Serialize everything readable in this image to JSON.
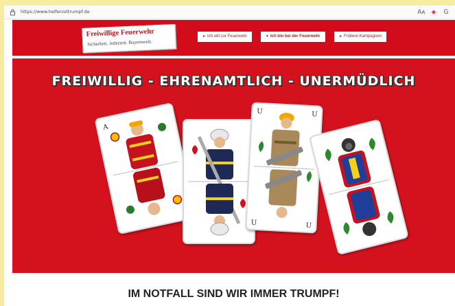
{
  "browser": {
    "url": "https://www.helfenisttrumpf.de",
    "icons": [
      "lock-icon",
      "translate-icon",
      "shield-extension-icon",
      "grid-icon"
    ]
  },
  "header": {
    "logo_title": "Freiwillige Feuerwehr",
    "logo_subtitle": "Sicherheit. Jederzeit. Bayernweit.",
    "nav": [
      {
        "label": "Ich will zur Feuerwehr",
        "active": false
      },
      {
        "label": "Ich bin bei der Feuerwehr",
        "active": true
      },
      {
        "label": "Frühere Kampagnen",
        "active": false
      }
    ]
  },
  "hero": {
    "headline": "FREIWILLIG - EHRENAMTLICH - UNERMÜDLICH",
    "cards": [
      {
        "name": "firefighter-card-red-suit",
        "corner_top": "A",
        "suit": "bells"
      },
      {
        "name": "firefighter-card-helmet-hearts",
        "corner_top": "",
        "suit": "hearts"
      },
      {
        "name": "firefighter-card-chainsaw",
        "corner_top": "U",
        "suit": "leaves"
      },
      {
        "name": "firefighter-card-breathing",
        "corner_top": "",
        "suit": "leaves"
      }
    ]
  },
  "footer": {
    "tagline": "IM NOTFALL SIND WIR IMMER TRUMPF!"
  },
  "colors": {
    "brand_red": "#d4121e",
    "page_bg": "#f6eb9e"
  }
}
